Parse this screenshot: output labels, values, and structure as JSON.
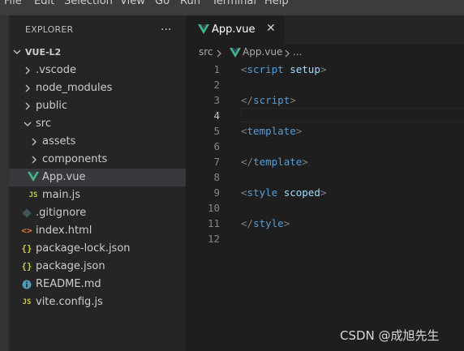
{
  "menu": [
    "File",
    "Edit",
    "Selection",
    "View",
    "Go",
    "Run",
    "Terminal",
    "Help"
  ],
  "sidebar": {
    "title": "EXPLORER",
    "more_icon": "...",
    "project": "VUE-L2",
    "items": [
      {
        "label": ".vscode",
        "icon": "none"
      },
      {
        "label": "node_modules",
        "icon": "none"
      },
      {
        "label": "public",
        "icon": "none"
      },
      {
        "label": "src",
        "icon": "none"
      },
      {
        "label": "assets",
        "icon": "none"
      },
      {
        "label": "components",
        "icon": "none"
      },
      {
        "label": "App.vue",
        "icon": "vue-icon"
      },
      {
        "label": "main.js",
        "icon": "js-icon",
        "icon_text": "JS"
      },
      {
        "label": ".gitignore",
        "icon": "git-icon"
      },
      {
        "label": "index.html",
        "icon": "html-icon",
        "icon_text": "<>"
      },
      {
        "label": "package-lock.json",
        "icon": "json-icon",
        "icon_text": "{}"
      },
      {
        "label": "package.json",
        "icon": "json-icon",
        "icon_text": "{}"
      },
      {
        "label": "README.md",
        "icon": "info-icon"
      },
      {
        "label": "vite.config.js",
        "icon": "js-icon",
        "icon_text": "JS"
      }
    ]
  },
  "editor": {
    "tab_label": "App.vue",
    "tab_close": "✕",
    "breadcrumb": {
      "folder": "src",
      "file": "App.vue",
      "symbol": "..."
    },
    "line_numbers": [
      "1",
      "2",
      "3",
      "4",
      "5",
      "6",
      "7",
      "8",
      "9",
      "10",
      "11",
      "12"
    ],
    "lines": {
      "l1": {
        "open": "<",
        "name": "script",
        "attr": "setup",
        "close": ">"
      },
      "l3": {
        "open": "</",
        "name": "script",
        "close": ">"
      },
      "l5": {
        "open": "<",
        "name": "template",
        "close": ">"
      },
      "l7": {
        "open": "</",
        "name": "template",
        "close": ">"
      },
      "l9": {
        "open": "<",
        "name": "style",
        "attr": "scoped",
        "close": ">"
      },
      "l11": {
        "open": "</",
        "name": "style",
        "close": ">"
      }
    }
  },
  "watermark": "CSDN @成旭先生",
  "colors": {
    "vue_green": "#42b883",
    "js_yellow": "#cbcb41",
    "html_orange": "#e37933",
    "info_blue": "#519aba",
    "git_gray": "#41535b"
  }
}
